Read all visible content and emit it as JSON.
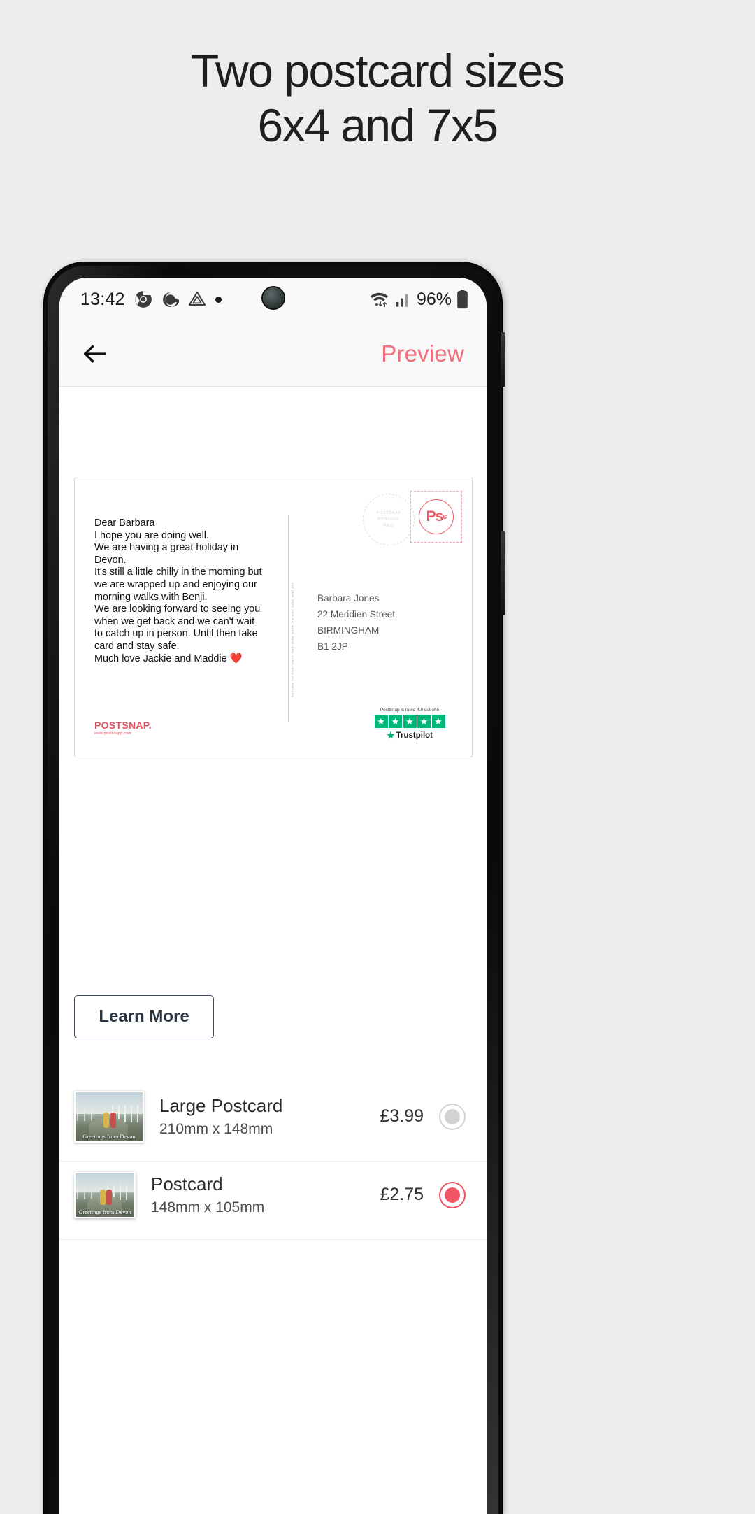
{
  "marketing": {
    "headline_line1": "Two postcard sizes",
    "headline_line2": "6x4 and 7x5",
    "background_color": "#ededed"
  },
  "status_bar": {
    "time": "13:42",
    "icons": [
      "chrome-icon",
      "google-icon",
      "drive-icon",
      "notification-dot"
    ],
    "wifi": "wifi-icon",
    "signal": "signal-icon",
    "battery_percent": "96%",
    "battery": "battery-icon"
  },
  "app_bar": {
    "back": "back-arrow-icon",
    "title": "Preview",
    "title_color": "#f0707c"
  },
  "postcard": {
    "message": "Dear Barbara\nI hope you are doing well.\nWe are having a great holiday in\nDevon.\nIt's still a little chilly in the morning but\nwe are wrapped up and enjoying our\nmorning walks with Benji.\nWe are looking forward to seeing you\nwhen we get back and we can't wait\nto catch up in person. Until then take\ncard and stay safe.\n Much love Jackie and Maddie ❤️",
    "brand_name": "POSTSNAP.",
    "brand_url": "www.postsnapp.com",
    "postmark_top": "POSTSNAP",
    "postmark_mid": "POSTAGE",
    "postmark_bottom": "PAID",
    "stamp_label": "Ps",
    "stamp_sup": "c",
    "vertical_text": "RETURN TO POSTSNAP, RETURNS DEPT, PO BOX 1234, BN3 1AA",
    "address": [
      "Barbara Jones",
      "22 Meridien Street",
      "BIRMINGHAM",
      "B1 2JP"
    ],
    "trustpilot_label": "PostSnap is rated 4.8 out of 5",
    "trustpilot_name": "Trustpilot",
    "trustpilot_stars": 5,
    "trustpilot_color": "#00b67a"
  },
  "learn_more": {
    "label": "Learn More"
  },
  "products": [
    {
      "title": "Large Postcard",
      "dimensions": "210mm x 148mm",
      "price": "£3.99",
      "selected": false,
      "thumb_caption": "Greetings from Devon"
    },
    {
      "title": "Postcard",
      "dimensions": "148mm x 105mm",
      "price": "£2.75",
      "selected": true,
      "thumb_caption": "Greetings from Devon"
    }
  ],
  "accent_color": "#f05563"
}
